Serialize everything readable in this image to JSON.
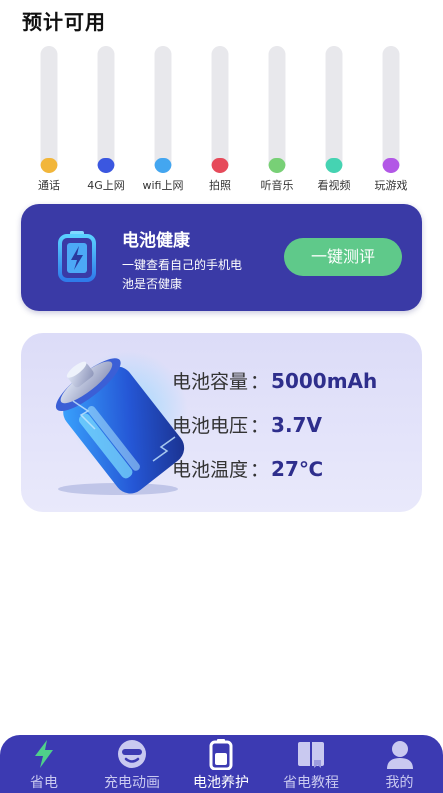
{
  "page": {
    "title": "预计可用"
  },
  "usage": [
    {
      "label": "通话",
      "color": "#f2b63a",
      "level": 0.12
    },
    {
      "label": "4G上网",
      "color": "#3b57e0",
      "level": 0.12
    },
    {
      "label": "wifi上网",
      "color": "#43a6f0",
      "level": 0.12
    },
    {
      "label": "拍照",
      "color": "#e64a5a",
      "level": 0.12
    },
    {
      "label": "听音乐",
      "color": "#78d076",
      "level": 0.12
    },
    {
      "label": "看视频",
      "color": "#45d3b2",
      "level": 0.12
    },
    {
      "label": "玩游戏",
      "color": "#b257e6",
      "level": 0.12
    }
  ],
  "health": {
    "title": "电池健康",
    "description": "一键查看自己的手机电池是否健康",
    "button_label": "一键测评",
    "icon": "battery-charging-icon"
  },
  "info": {
    "capacity_label": "电池容量",
    "capacity_value": "5000mAh",
    "voltage_label": "电池电压",
    "voltage_value": "3.7V",
    "temperature_label": "电池温度",
    "temperature_value": "27℃",
    "colon": "："
  },
  "nav": {
    "items": [
      {
        "label": "省电",
        "icon": "lightning-icon"
      },
      {
        "label": "充电动画",
        "icon": "smile-face-icon"
      },
      {
        "label": "电池养护",
        "icon": "battery-icon"
      },
      {
        "label": "省电教程",
        "icon": "book-icon"
      },
      {
        "label": "我的",
        "icon": "user-icon"
      }
    ],
    "active_index": 2
  },
  "colors": {
    "accent": "#3c3ab2",
    "button_green": "#5fc98a",
    "value_text": "#2e2e8c"
  }
}
